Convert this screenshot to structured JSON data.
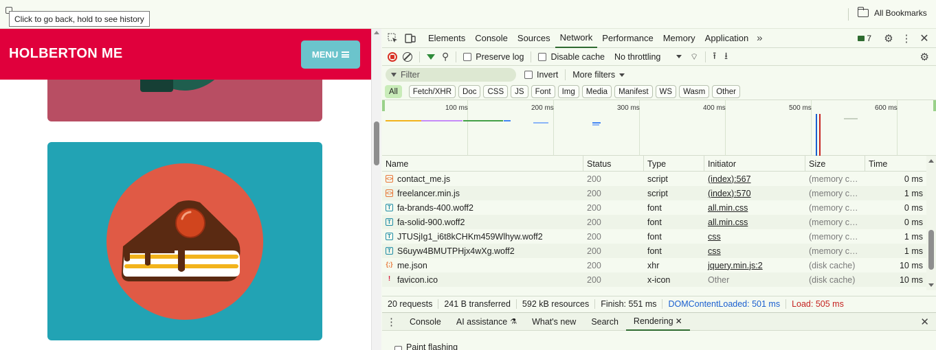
{
  "browser": {
    "tooltip": "Click to go back, hold to see history",
    "bookmarks_label": "All Bookmarks"
  },
  "site": {
    "brand": "HOLBERTON ME",
    "menu_label": "MENU"
  },
  "devtools": {
    "tabs": [
      "Elements",
      "Console",
      "Sources",
      "Network",
      "Performance",
      "Memory",
      "Application"
    ],
    "active_tab": "Network",
    "issues_count": "7",
    "toolbar": {
      "preserve_log": "Preserve log",
      "disable_cache": "Disable cache",
      "throttling": "No throttling"
    },
    "filter": {
      "placeholder": "Filter",
      "invert": "Invert",
      "more_filters": "More filters"
    },
    "types": [
      "All",
      "Fetch/XHR",
      "Doc",
      "CSS",
      "JS",
      "Font",
      "Img",
      "Media",
      "Manifest",
      "WS",
      "Wasm",
      "Other"
    ],
    "overview_ticks": [
      "100 ms",
      "200 ms",
      "300 ms",
      "400 ms",
      "500 ms",
      "600 ms"
    ],
    "columns": [
      "Name",
      "Status",
      "Type",
      "Initiator",
      "Size",
      "Time"
    ],
    "rows": [
      {
        "name": "contact_me.js",
        "status": "200",
        "type": "script",
        "initiator": "(index):567",
        "size": "(memory cac...",
        "time": "0 ms",
        "kind": "script"
      },
      {
        "name": "freelancer.min.js",
        "status": "200",
        "type": "script",
        "initiator": "(index):570",
        "size": "(memory cac...",
        "time": "1 ms",
        "kind": "script"
      },
      {
        "name": "fa-brands-400.woff2",
        "status": "200",
        "type": "font",
        "initiator": "all.min.css",
        "size": "(memory cac...",
        "time": "0 ms",
        "kind": "font"
      },
      {
        "name": "fa-solid-900.woff2",
        "status": "200",
        "type": "font",
        "initiator": "all.min.css",
        "size": "(memory cac...",
        "time": "0 ms",
        "kind": "font"
      },
      {
        "name": "JTUSjIg1_i6t8kCHKm459Wlhyw.woff2",
        "status": "200",
        "type": "font",
        "initiator": "css",
        "size": "(memory cac...",
        "time": "1 ms",
        "kind": "font"
      },
      {
        "name": "S6uyw4BMUTPHjx4wXg.woff2",
        "status": "200",
        "type": "font",
        "initiator": "css",
        "size": "(memory cac...",
        "time": "1 ms",
        "kind": "font"
      },
      {
        "name": "me.json",
        "status": "200",
        "type": "xhr",
        "initiator": "jquery.min.js:2",
        "size": "(disk cache)",
        "time": "10 ms",
        "kind": "xhr"
      },
      {
        "name": "favicon.ico",
        "status": "200",
        "type": "x-icon",
        "initiator": "Other",
        "size": "(disk cache)",
        "time": "10 ms",
        "kind": "ico"
      }
    ],
    "summary": {
      "requests": "20 requests",
      "transferred": "241 B transferred",
      "resources": "592 kB resources",
      "finish": "Finish: 551 ms",
      "dom_content_loaded": "DOMContentLoaded: 501 ms",
      "load": "Load: 505 ms"
    },
    "drawer_tabs": [
      "Console",
      "AI assistance",
      "What's new",
      "Search",
      "Rendering"
    ],
    "drawer_active": "Rendering",
    "paint_flashing": "Paint flashing",
    "colors": {
      "accent_green": "#2e6b30",
      "dom_blue": "#1a5fd0",
      "load_red": "#c5221f",
      "site_red": "#e0003c",
      "site_teal": "#22a3b4"
    }
  }
}
